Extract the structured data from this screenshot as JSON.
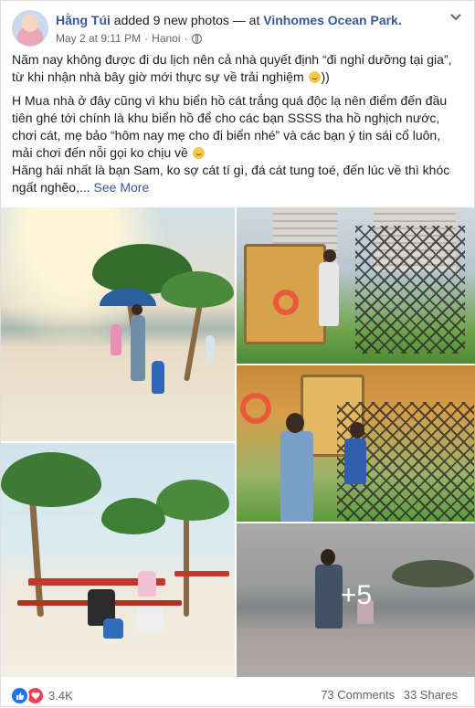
{
  "header": {
    "author": "Hằng Túi",
    "action": "added 9 new photos",
    "separator": "— at",
    "place": "Vinhomes Ocean Park.",
    "date": "May 2 at 9:11 PM",
    "dot": "·",
    "location": "Hanoi",
    "dot2": "·",
    "icons": [
      "avatar",
      "globe-icon",
      "chevron-down-icon"
    ]
  },
  "post_text": {
    "p1_a": "Năm nay không được đi du lịch nên cả nhà quyết định “đi nghỉ dưỡng tại gia”, từ khi nhận nhà bây giờ mới thực sự về trải nghiệm",
    "p1_b": "))",
    "p2_a": "H Mua nhà ở đây cũng vì khu biển hồ cát trắng quá độc lạ nên điểm đến đầu tiên ghé tới chính là khu biển hồ để cho các bạn SSSS tha hồ nghịch nước, chơi cát, mẹ bảo “hôm nay mẹ cho đi biển nhé” và các bạn ý tin sái cổ luôn, mải chơi đến nỗi gọi ko chịu về",
    "p3": "Hăng hái nhất là bạn Sam, ko sợ cát tí gì, đá cát tung toé, đến lúc về thì khóc ngất nghẽo,...",
    "see_more": "See More"
  },
  "photos": {
    "more_count": "+5"
  },
  "footer": {
    "reaction_count": "3.4K",
    "comments": "73 Comments",
    "shares": "33 Shares",
    "like_color": "#1877f2",
    "love_color": "#f33e58"
  }
}
